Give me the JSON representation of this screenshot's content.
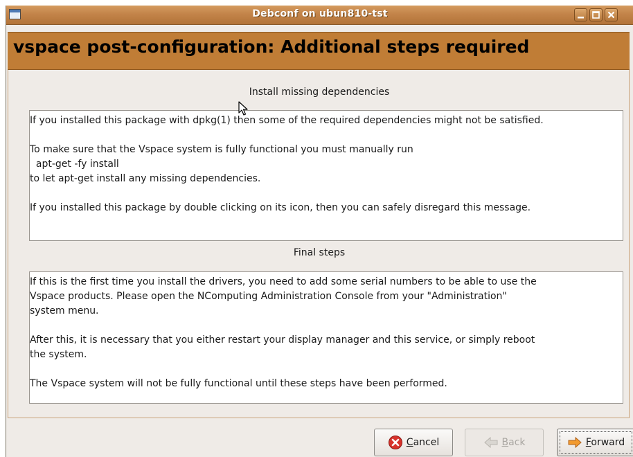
{
  "window": {
    "title": "Debconf on ubun810-tst",
    "controls": [
      "minimize",
      "maximize",
      "close"
    ]
  },
  "banner": {
    "title": "vspace post-configuration: Additional steps required"
  },
  "section1": {
    "label": "Install missing dependencies",
    "lines": [
      "If you installed this package with dpkg(1) then some of the required dependencies might not be satisfied.",
      "",
      "To make sure that the Vspace system is fully functional you must manually run",
      "  apt-get -fy install",
      "to let apt-get install any missing dependencies.",
      "",
      "If you installed this package by double clicking on its icon, then you can safely disregard this message."
    ]
  },
  "section2": {
    "label": "Final steps",
    "lines": [
      "If this is the first time you install the drivers, you need to add some serial numbers to be able to use the",
      "Vspace products. Please open the NComputing Administration Console from your \"Administration\"",
      "system menu.",
      "",
      "After this, it is necessary that you either restart your display manager and this service, or simply reboot",
      "the system.",
      "",
      "The Vspace system will not be fully functional until these steps have been performed."
    ]
  },
  "buttons": {
    "cancel": {
      "mnemonic": "C",
      "rest": "ancel",
      "icon": "cancel-icon"
    },
    "back": {
      "mnemonic": "B",
      "rest": "ack",
      "icon": "back-arrow-icon"
    },
    "forward": {
      "mnemonic": "F",
      "rest": "orward",
      "icon": "forward-arrow-icon"
    }
  },
  "colors": {
    "titlebar": "#c3844a",
    "banner": "#c07d36",
    "window_bg": "#efebe7"
  }
}
